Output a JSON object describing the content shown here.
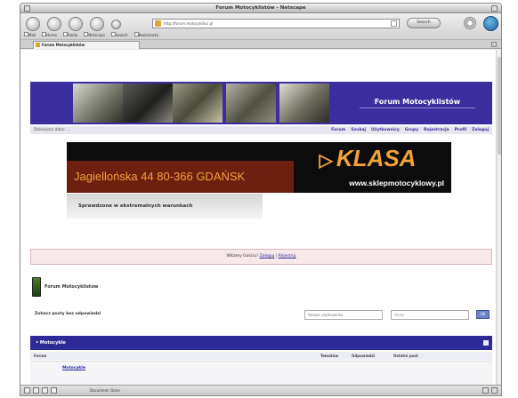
{
  "window": {
    "title": "Forum Motocyklistów - Netscape"
  },
  "toolbar": {
    "url": "http://forum.motocyklisci.pl",
    "search_label": "Search",
    "bookmarks": [
      "Mail",
      "Home",
      "Radio",
      "Netscape",
      "Search",
      "Bookmarks"
    ]
  },
  "tab": {
    "label": "Forum Motocyklistów"
  },
  "header": {
    "site_title": "Forum Motocyklistów"
  },
  "linkrow": {
    "date": "Dzisiejsza data: ...",
    "links": [
      "Forum",
      "Szukaj",
      "Użytkownicy",
      "Grupy",
      "Rejestracja",
      "Profil",
      "Zaloguj"
    ]
  },
  "ad": {
    "address": "Jagiellońska 44  80-366 GDAŃSK",
    "brand": "KLASA",
    "website": "www.sklepmotocyklowy.pl"
  },
  "tagline": "Sprawdzone w ekstremalnych warunkach",
  "welcome": {
    "prefix": "Witamy Gościu!",
    "login": "Zaloguj",
    "register": "Rejestruj"
  },
  "forum": {
    "title": "Forum Motocyklistów"
  },
  "actions": {
    "label": "Zobacz posty bez odpowiedzi",
    "search_placeholder": "Nazwa użytkownika",
    "password_placeholder": "Hasło",
    "go_label": "OK"
  },
  "category": {
    "title": "• Motocykle"
  },
  "columns": [
    "Forum",
    "Tematów",
    "Odpowiedzi",
    "Ostatni post"
  ],
  "rows": [
    {
      "name": "Motocykle"
    }
  ],
  "status": {
    "text": "Document: Done"
  }
}
